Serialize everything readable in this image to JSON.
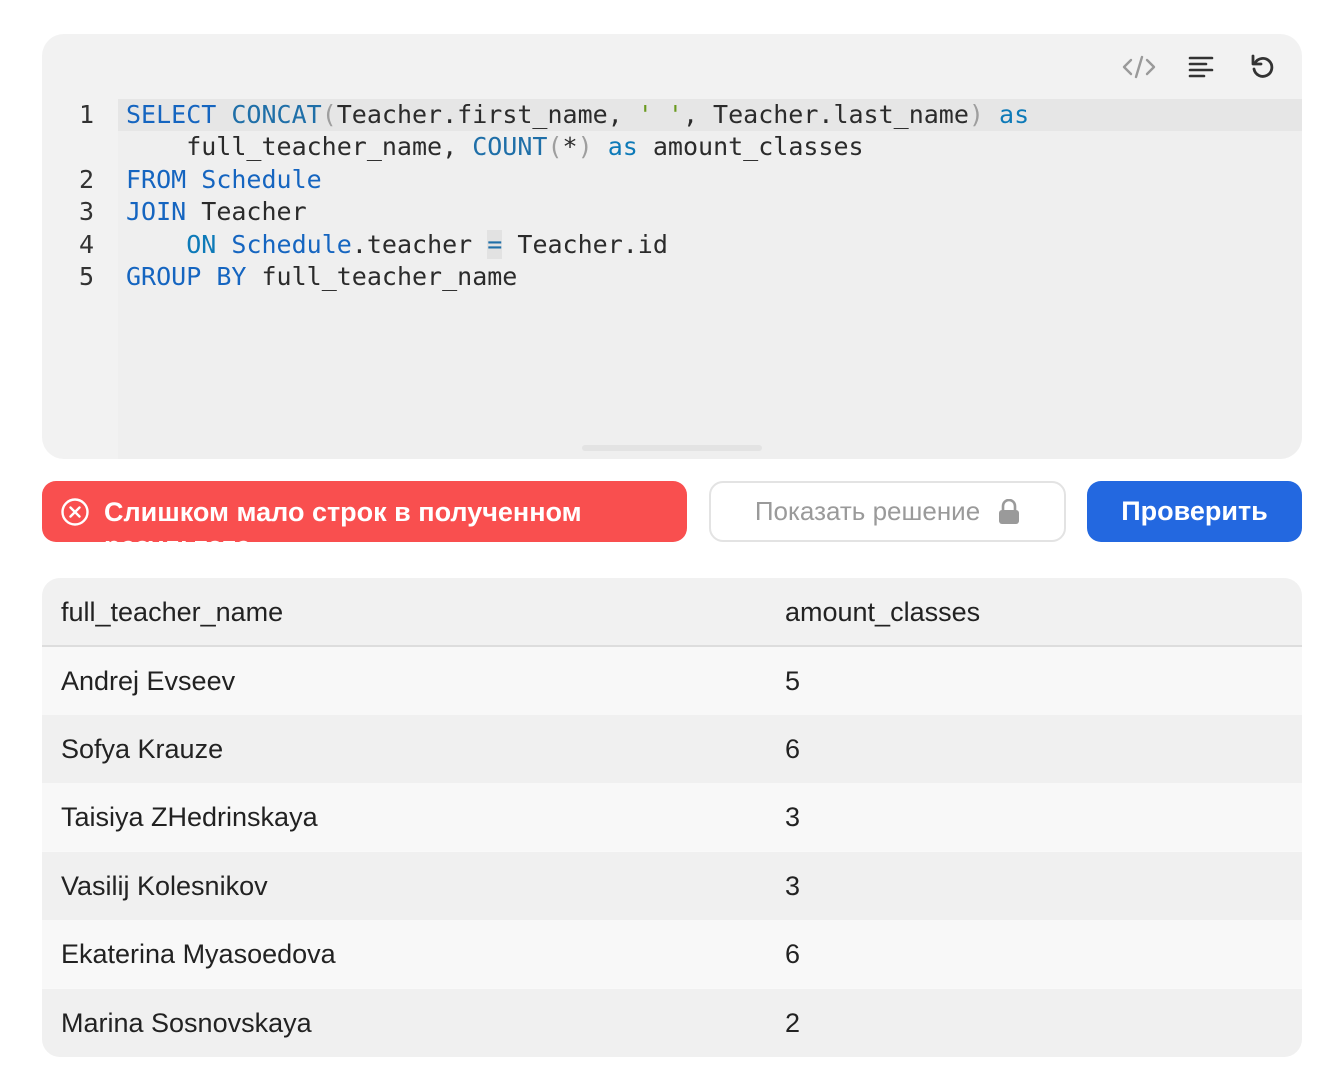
{
  "toolbar": {
    "icons": [
      "code-icon",
      "format-icon",
      "reset-icon"
    ]
  },
  "editor": {
    "line_numbers": [
      "1",
      "2",
      "3",
      "4",
      "5"
    ],
    "lines": [
      "SELECT CONCAT(Teacher.first_name, ' ', Teacher.last_name) as",
      "    full_teacher_name, COUNT(*) as amount_classes",
      "FROM Schedule",
      "JOIN Teacher",
      "    ON Schedule.teacher = Teacher.id",
      "GROUP BY full_teacher_name"
    ]
  },
  "status": {
    "error_message": "Слишком мало строк в полученном результате",
    "icon": "close-circle-icon",
    "color": "#f94f4f"
  },
  "actions": {
    "show_solution_label": "Показать решение",
    "show_solution_icon": "lock-icon",
    "check_label": "Проверить",
    "check_color": "#2368e0"
  },
  "result": {
    "columns": [
      "full_teacher_name",
      "amount_classes"
    ],
    "rows": [
      [
        "Andrej Evseev",
        "5"
      ],
      [
        "Sofya Krauze",
        "6"
      ],
      [
        "Taisiya ZHedrinskaya",
        "3"
      ],
      [
        "Vasilij Kolesnikov",
        "3"
      ],
      [
        "Ekaterina Myasoedova",
        "6"
      ],
      [
        "Marina Sosnovskaya",
        "2"
      ]
    ]
  }
}
